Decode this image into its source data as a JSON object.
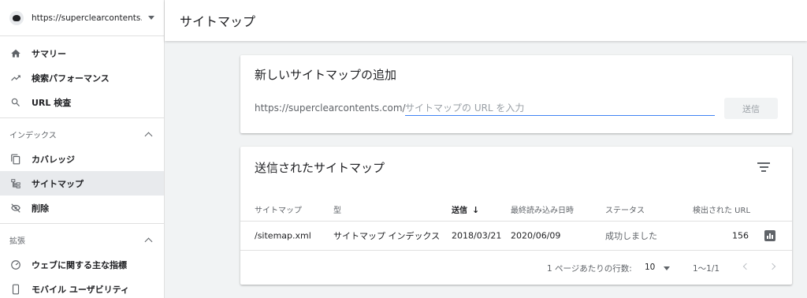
{
  "property": {
    "url": "https://superclearcontents.c..."
  },
  "sidebar": {
    "items_top": [
      {
        "label": "サマリー",
        "icon": "home-icon"
      },
      {
        "label": "検索パフォーマンス",
        "icon": "trending-up-icon"
      },
      {
        "label": "URL 検査",
        "icon": "search-icon"
      }
    ],
    "index_section": {
      "title": "インデックス",
      "items": [
        {
          "label": "カバレッジ",
          "icon": "copy-icon"
        },
        {
          "label": "サイトマップ",
          "icon": "sitemap-icon",
          "active": true
        },
        {
          "label": "削除",
          "icon": "visibility-off-icon"
        }
      ]
    },
    "ext_section": {
      "title": "拡張",
      "items": [
        {
          "label": "ウェブに関する主な指標",
          "icon": "speed-icon"
        },
        {
          "label": "モバイル ユーザビリティ",
          "icon": "smartphone-icon"
        }
      ]
    }
  },
  "header": {
    "title": "サイトマップ"
  },
  "add_card": {
    "title": "新しいサイトマップの追加",
    "url_prefix": "https://superclearcontents.com/",
    "input_placeholder": "サイトマップの URL を入力",
    "input_value": "",
    "submit_label": "送信"
  },
  "submitted_card": {
    "title": "送信されたサイトマップ",
    "columns": [
      "サイトマップ",
      "型",
      "送信",
      "最終読み込み日時",
      "ステータス",
      "検出された URL"
    ],
    "sort_arrow": "↓",
    "rows": [
      {
        "sitemap": "/sitemap.xml",
        "type": "サイトマップ インデックス",
        "submitted": "2018/03/21",
        "last_read": "2020/06/09",
        "status": "成功しました",
        "urls": "156"
      }
    ],
    "pager": {
      "rows_per_page_label": "1 ページあたりの行数:",
      "rows_per_page": "10",
      "range": "1〜1/1"
    }
  },
  "colors": {
    "accent": "#4285f4",
    "text": "#202124",
    "muted": "#5f6368",
    "background": "#f1f3f4"
  }
}
